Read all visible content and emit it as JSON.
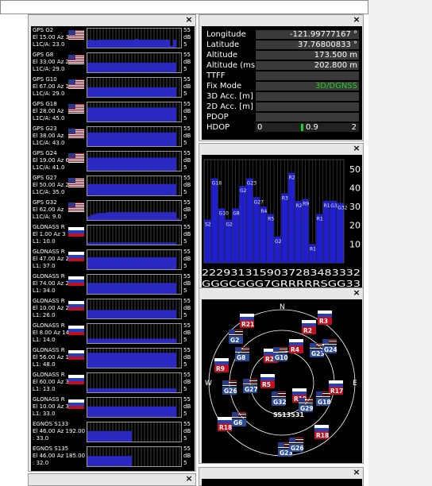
{
  "window": {
    "close_glyph": "×"
  },
  "sat_rows": [
    {
      "name": "GPS G2",
      "line2": "El 15.00 Az 31",
      "line3": "L1C/A: 23.0",
      "flag": "us",
      "max": "55",
      "unit": "dB",
      "min": "5",
      "bars": [
        0.45,
        0.45,
        0.42,
        0.45,
        0.45,
        0.45,
        0.45,
        0.45,
        0.45,
        0.45,
        0.45,
        0.45,
        0.45,
        0.45,
        0.45,
        0.5,
        0.45,
        0.45,
        0.45,
        0.45,
        0.45,
        0.45,
        0.45,
        0.45,
        0.45,
        0.45,
        0.1,
        0.45,
        0,
        0
      ]
    },
    {
      "name": "GPS G8",
      "line2": "El 33.00 Az 2",
      "line3": "L1C/A: 29.0",
      "flag": "us",
      "max": "55",
      "unit": "dB",
      "min": "5",
      "bars": [
        0.55,
        0.55,
        0.55,
        0.55,
        0.55,
        0.55,
        0.55,
        0.55,
        0.55,
        0.55,
        0.55,
        0.55,
        0.55,
        0.55,
        0.55,
        0.55,
        0.55,
        0.55,
        0.55,
        0.55,
        0.55,
        0.55,
        0.55,
        0.55,
        0.55,
        0.55,
        0.55,
        0.55,
        0,
        0
      ]
    },
    {
      "name": "GPS G10",
      "line2": "El 67.00 Az 1",
      "line3": "L1C/A: 29.0",
      "flag": "us",
      "max": "55",
      "unit": "dB",
      "min": "5",
      "bars": [
        0.55,
        0.55,
        0.55,
        0.55,
        0.55,
        0.55,
        0.55,
        0.55,
        0.55,
        0.55,
        0.55,
        0.55,
        0.55,
        0.55,
        0.55,
        0.55,
        0.55,
        0.55,
        0.55,
        0.55,
        0.55,
        0.55,
        0.55,
        0.55,
        0.55,
        0.55,
        0.55,
        0.55,
        0,
        0
      ]
    },
    {
      "name": "GPS G18",
      "line2": "El 28.00 Az",
      "line3": "L1C/A: 45.0",
      "flag": "us",
      "max": "55",
      "unit": "dB",
      "min": "5",
      "bars": [
        0.8,
        0.8,
        0.8,
        0.8,
        0.8,
        0.8,
        0.8,
        0.8,
        0.8,
        0.8,
        0.8,
        0.8,
        0.8,
        0.8,
        0.8,
        0.8,
        0.8,
        0.8,
        0.8,
        0.8,
        0.8,
        0.8,
        0.8,
        0.8,
        0.8,
        0.8,
        0.8,
        0.8,
        0,
        0
      ]
    },
    {
      "name": "GPS G23",
      "line2": "El 38.00 Az",
      "line3": "L1C/A: 43.0",
      "flag": "us",
      "max": "55",
      "unit": "dB",
      "min": "5",
      "bars": [
        0.78,
        0.78,
        0.78,
        0.78,
        0.78,
        0.78,
        0.78,
        0.78,
        0.78,
        0.78,
        0.78,
        0.78,
        0.78,
        0.78,
        0.78,
        0.78,
        0.78,
        0.78,
        0.78,
        0.78,
        0.78,
        0.78,
        0.78,
        0.78,
        0.78,
        0.78,
        0.78,
        0.78,
        0,
        0
      ]
    },
    {
      "name": "GPS G24",
      "line2": "El 19.00 Az 6",
      "line3": "L1C/A: 41.0",
      "flag": "us",
      "max": "55",
      "unit": "dB",
      "min": "5",
      "bars": [
        0.75,
        0.75,
        0.75,
        0.75,
        0.75,
        0.75,
        0.75,
        0.75,
        0.75,
        0.75,
        0.75,
        0.75,
        0.75,
        0.75,
        0.75,
        0.75,
        0.75,
        0.75,
        0.75,
        0.75,
        0.75,
        0.75,
        0.75,
        0.75,
        0.75,
        0.75,
        0.75,
        0.75,
        0,
        0
      ]
    },
    {
      "name": "GPS G27",
      "line2": "El 50.00 Az 2",
      "line3": "L1C/A: 35.0",
      "flag": "us",
      "max": "55",
      "unit": "dB",
      "min": "5",
      "bars": [
        0.65,
        0.65,
        0.65,
        0.65,
        0.65,
        0.65,
        0.65,
        0.65,
        0.65,
        0.65,
        0.65,
        0.65,
        0.65,
        0.65,
        0.65,
        0.65,
        0.65,
        0.65,
        0.65,
        0.65,
        0.65,
        0.65,
        0.65,
        0.65,
        0.65,
        0.65,
        0.65,
        0.65,
        0,
        0
      ]
    },
    {
      "name": "GPS G32",
      "line2": "El 62.00 Az",
      "line3": "L1C/A: 9.0",
      "flag": "us",
      "max": "55",
      "unit": "dB",
      "min": "5",
      "bars": [
        0.2,
        0.3,
        0.35,
        0.4,
        0.4,
        0.4,
        0.45,
        0.45,
        0.45,
        0.45,
        0.45,
        0.45,
        0.45,
        0.45,
        0.45,
        0.45,
        0.45,
        0.45,
        0.45,
        0.45,
        0.45,
        0.45,
        0.45,
        0.45,
        0.45,
        0.45,
        0.45,
        0.45,
        0.1,
        0
      ]
    },
    {
      "name": "GLONASS R",
      "line2": "El 1.00 Az 3",
      "line3": "L1: 10.0",
      "flag": "ru",
      "max": "55",
      "unit": "dB",
      "min": "5",
      "bars": [
        0.12,
        0.12,
        0.12,
        0.12,
        0.12,
        0.12,
        0.12,
        0.12,
        0.12,
        0.12,
        0.12,
        0.12,
        0.12,
        0.12,
        0.12,
        0.12,
        0.12,
        0.12,
        0.12,
        0.12,
        0.12,
        0.12,
        0.12,
        0.12,
        0.12,
        0.12,
        0.12,
        0.12,
        0,
        0
      ]
    },
    {
      "name": "GLONASS R",
      "line2": "El 47.00 Az 2",
      "line3": "L1: 37.0",
      "flag": "ru",
      "max": "55",
      "unit": "dB",
      "min": "5",
      "bars": [
        0.68,
        0.68,
        0.68,
        0.68,
        0.68,
        0.68,
        0.68,
        0.68,
        0.68,
        0.68,
        0.68,
        0.68,
        0.68,
        0.68,
        0.68,
        0.68,
        0.68,
        0.68,
        0.68,
        0.68,
        0.68,
        0.68,
        0.68,
        0.68,
        0.68,
        0.68,
        0.68,
        0.68,
        0,
        0
      ]
    },
    {
      "name": "GLONASS R",
      "line2": "El 74.00 Az 2",
      "line3": "L1: 34.0",
      "flag": "ru",
      "max": "55",
      "unit": "dB",
      "min": "5",
      "bars": [
        0.62,
        0.62,
        0.62,
        0.62,
        0.62,
        0.62,
        0.62,
        0.62,
        0.62,
        0.62,
        0.62,
        0.62,
        0.62,
        0.62,
        0.62,
        0.62,
        0.62,
        0.62,
        0.62,
        0.62,
        0.62,
        0.62,
        0.62,
        0.62,
        0.62,
        0.62,
        0.62,
        0.62,
        0,
        0
      ]
    },
    {
      "name": "GLONASS R",
      "line2": "El 10.00 Az 2",
      "line3": "L1: 26.0",
      "flag": "ru",
      "max": "55",
      "unit": "dB",
      "min": "5",
      "bars": [
        0.48,
        0.48,
        0.48,
        0.48,
        0.48,
        0.48,
        0.48,
        0.48,
        0.48,
        0.48,
        0.48,
        0.48,
        0.48,
        0.48,
        0.48,
        0.48,
        0.48,
        0.48,
        0.48,
        0.48,
        0.48,
        0.48,
        0.48,
        0.48,
        0.48,
        0.48,
        0.48,
        0.48,
        0,
        0
      ]
    },
    {
      "name": "GLONASS R",
      "line2": "El 8.00 Az 14",
      "line3": "L1: 14.0",
      "flag": "ru",
      "max": "55",
      "unit": "dB",
      "min": "5",
      "bars": [
        0.25,
        0.25,
        0.25,
        0.25,
        0.25,
        0.25,
        0.25,
        0.25,
        0.25,
        0.25,
        0.25,
        0.25,
        0.25,
        0.25,
        0.25,
        0.25,
        0.25,
        0.25,
        0.25,
        0.25,
        0.25,
        0.25,
        0.25,
        0.25,
        0.25,
        0.25,
        0.25,
        0.25,
        0,
        0
      ]
    },
    {
      "name": "GLONASS R",
      "line2": "El 56.00 Az 1",
      "line3": "L1: 48.0",
      "flag": "ru",
      "max": "55",
      "unit": "dB",
      "min": "5",
      "bars": [
        0.85,
        0.85,
        0.85,
        0.85,
        0.85,
        0.85,
        0.85,
        0.85,
        0.85,
        0.85,
        0.85,
        0.85,
        0.85,
        0.85,
        0.85,
        0.85,
        0.85,
        0.85,
        0.85,
        0.85,
        0.85,
        0.85,
        0.85,
        0.85,
        0.85,
        0.85,
        0.85,
        0.85,
        0,
        0
      ]
    },
    {
      "name": "GLONASS R",
      "line2": "El 60.00 Az 3",
      "line3": "L1: 13.0",
      "flag": "ru",
      "max": "55",
      "unit": "dB",
      "min": "5",
      "bars": [
        0.22,
        0.22,
        0.22,
        0.22,
        0.22,
        0.22,
        0.22,
        0.22,
        0.22,
        0.22,
        0.22,
        0.22,
        0.22,
        0.22,
        0.22,
        0.22,
        0.22,
        0.22,
        0.22,
        0.22,
        0.22,
        0.22,
        0.22,
        0.22,
        0.22,
        0.22,
        0.22,
        0.22,
        0,
        0
      ]
    },
    {
      "name": "GLONASS R",
      "line2": "El 10.00 Az 3",
      "line3": "L1: 33.0",
      "flag": "ru",
      "max": "55",
      "unit": "dB",
      "min": "5",
      "bars": [
        0.6,
        0.6,
        0.6,
        0.6,
        0.6,
        0.6,
        0.6,
        0.6,
        0.6,
        0.6,
        0.6,
        0.6,
        0.6,
        0.6,
        0.6,
        0.6,
        0.6,
        0.6,
        0.6,
        0.6,
        0.6,
        0.6,
        0.6,
        0.6,
        0.6,
        0.6,
        0.6,
        0.6,
        0,
        0
      ]
    },
    {
      "name": "EGNOS S133",
      "line2": "El 46.00 Az 192.00",
      "line3": ": 33.0",
      "flag": "",
      "max": "55",
      "unit": "dB",
      "min": "5",
      "bars": [
        0.6,
        0.6,
        0.6,
        0.6,
        0.6,
        0.6,
        0.6,
        0.6,
        0.6,
        0.6,
        0.6,
        0.6,
        0.6,
        0.6,
        0,
        0,
        0,
        0,
        0,
        0,
        0,
        0,
        0,
        0,
        0,
        0,
        0,
        0,
        0,
        0
      ]
    },
    {
      "name": "EGNOS S135",
      "line2": "El 46.00 Az 185.00",
      "line3": ": 32.0",
      "flag": "",
      "max": "55",
      "unit": "dB",
      "min": "5",
      "bars": [
        0.58,
        0.58,
        0.58,
        0.58,
        0.58,
        0.58,
        0.58,
        0.58,
        0.58,
        0.58,
        0.58,
        0.58,
        0.58,
        0.58,
        0,
        0,
        0,
        0,
        0,
        0,
        0,
        0,
        0,
        0,
        0,
        0,
        0,
        0,
        0,
        0
      ]
    }
  ],
  "info": {
    "rows": [
      {
        "k": "Longitude",
        "v": "-121.99777167 °"
      },
      {
        "k": "Latitude",
        "v": "37.76800833 °"
      },
      {
        "k": "Altitude",
        "v": "173.500 m"
      },
      {
        "k": "Altitude (msl)",
        "v": "202.800 m"
      },
      {
        "k": "TTFF",
        "v": ""
      },
      {
        "k": "Fix Mode",
        "v": "3D/DGNSS"
      },
      {
        "k": "3D Acc. [m]",
        "v": ""
      },
      {
        "k": "2D Acc. [m]",
        "v": ""
      },
      {
        "k": "PDOP",
        "v": ""
      }
    ],
    "hdop_label": "HDOP",
    "hdop_min": "0",
    "hdop_value": "0.9",
    "hdop_max": "2",
    "fix_color": "#20d020"
  },
  "chart_data": {
    "type": "bar",
    "y_ticks": [
      "50",
      "40",
      "30",
      "20",
      "10"
    ],
    "ylim": [
      0,
      55
    ],
    "categories": [
      "S2",
      "G18",
      "G10",
      "G2",
      "G8",
      "G24",
      "G18",
      "G27",
      "R4",
      "R5",
      "G20",
      "R3",
      "R2",
      "R20",
      "R9",
      "R18",
      "R17",
      "R16",
      "G3",
      "G32"
    ],
    "values": [
      23,
      45,
      29,
      23,
      29,
      41,
      45,
      35,
      30,
      26,
      14,
      37,
      48,
      33,
      34,
      10,
      26,
      33,
      33,
      32
    ],
    "bar_labels": [
      "S2",
      "G18",
      "G10",
      "G2",
      "G8",
      "G24",
      "G23",
      "G27",
      "R4",
      "R5",
      "G20",
      "R3",
      "R2",
      "R20",
      "R9",
      "R18",
      "R17",
      "R16",
      "G3",
      "G32"
    ],
    "bottom_values": "2229313159037283483332",
    "bottom_codes": "GGGCGGG7GRRRRRSGG33"
  },
  "sky": {
    "north": "N",
    "east": "E",
    "west": "W",
    "sats": [
      {
        "id": "R21",
        "type": "r",
        "x": 56,
        "y": 28
      },
      {
        "id": "R3",
        "type": "r",
        "x": 154,
        "y": 24
      },
      {
        "id": "R2",
        "type": "r",
        "x": 134,
        "y": 36
      },
      {
        "id": "G2",
        "type": "g",
        "x": 42,
        "y": 48
      },
      {
        "id": "R4",
        "type": "r",
        "x": 118,
        "y": 60
      },
      {
        "id": "G23",
        "type": "g",
        "x": 144,
        "y": 65
      },
      {
        "id": "G24",
        "type": "g",
        "x": 160,
        "y": 60
      },
      {
        "id": "G8",
        "type": "g",
        "x": 50,
        "y": 70
      },
      {
        "id": "R20",
        "type": "r",
        "x": 86,
        "y": 72
      },
      {
        "id": "G10",
        "type": "g",
        "x": 98,
        "y": 70
      },
      {
        "id": "R9",
        "type": "r",
        "x": 24,
        "y": 84
      },
      {
        "id": "R5",
        "type": "r",
        "x": 82,
        "y": 104
      },
      {
        "id": "G27",
        "type": "g",
        "x": 60,
        "y": 110
      },
      {
        "id": "G26",
        "type": "g",
        "x": 34,
        "y": 112
      },
      {
        "id": "R17",
        "type": "r",
        "x": 168,
        "y": 112
      },
      {
        "id": "G32",
        "type": "g",
        "x": 96,
        "y": 126
      },
      {
        "id": "R19",
        "type": "r",
        "x": 122,
        "y": 122
      },
      {
        "id": "G18",
        "type": "g",
        "x": 152,
        "y": 126
      },
      {
        "id": "G29",
        "type": "g",
        "x": 130,
        "y": 134
      },
      {
        "id": "SS13531",
        "type": "s",
        "x": 96,
        "y": 142
      },
      {
        "id": "R18",
        "type": "r",
        "x": 28,
        "y": 158
      },
      {
        "id": "G6",
        "type": "g",
        "x": 46,
        "y": 152
      },
      {
        "id": "R18",
        "type": "r",
        "x": 150,
        "y": 168
      },
      {
        "id": "G23",
        "type": "g",
        "x": 104,
        "y": 190
      },
      {
        "id": "G26",
        "type": "g",
        "x": 118,
        "y": 184
      }
    ]
  }
}
